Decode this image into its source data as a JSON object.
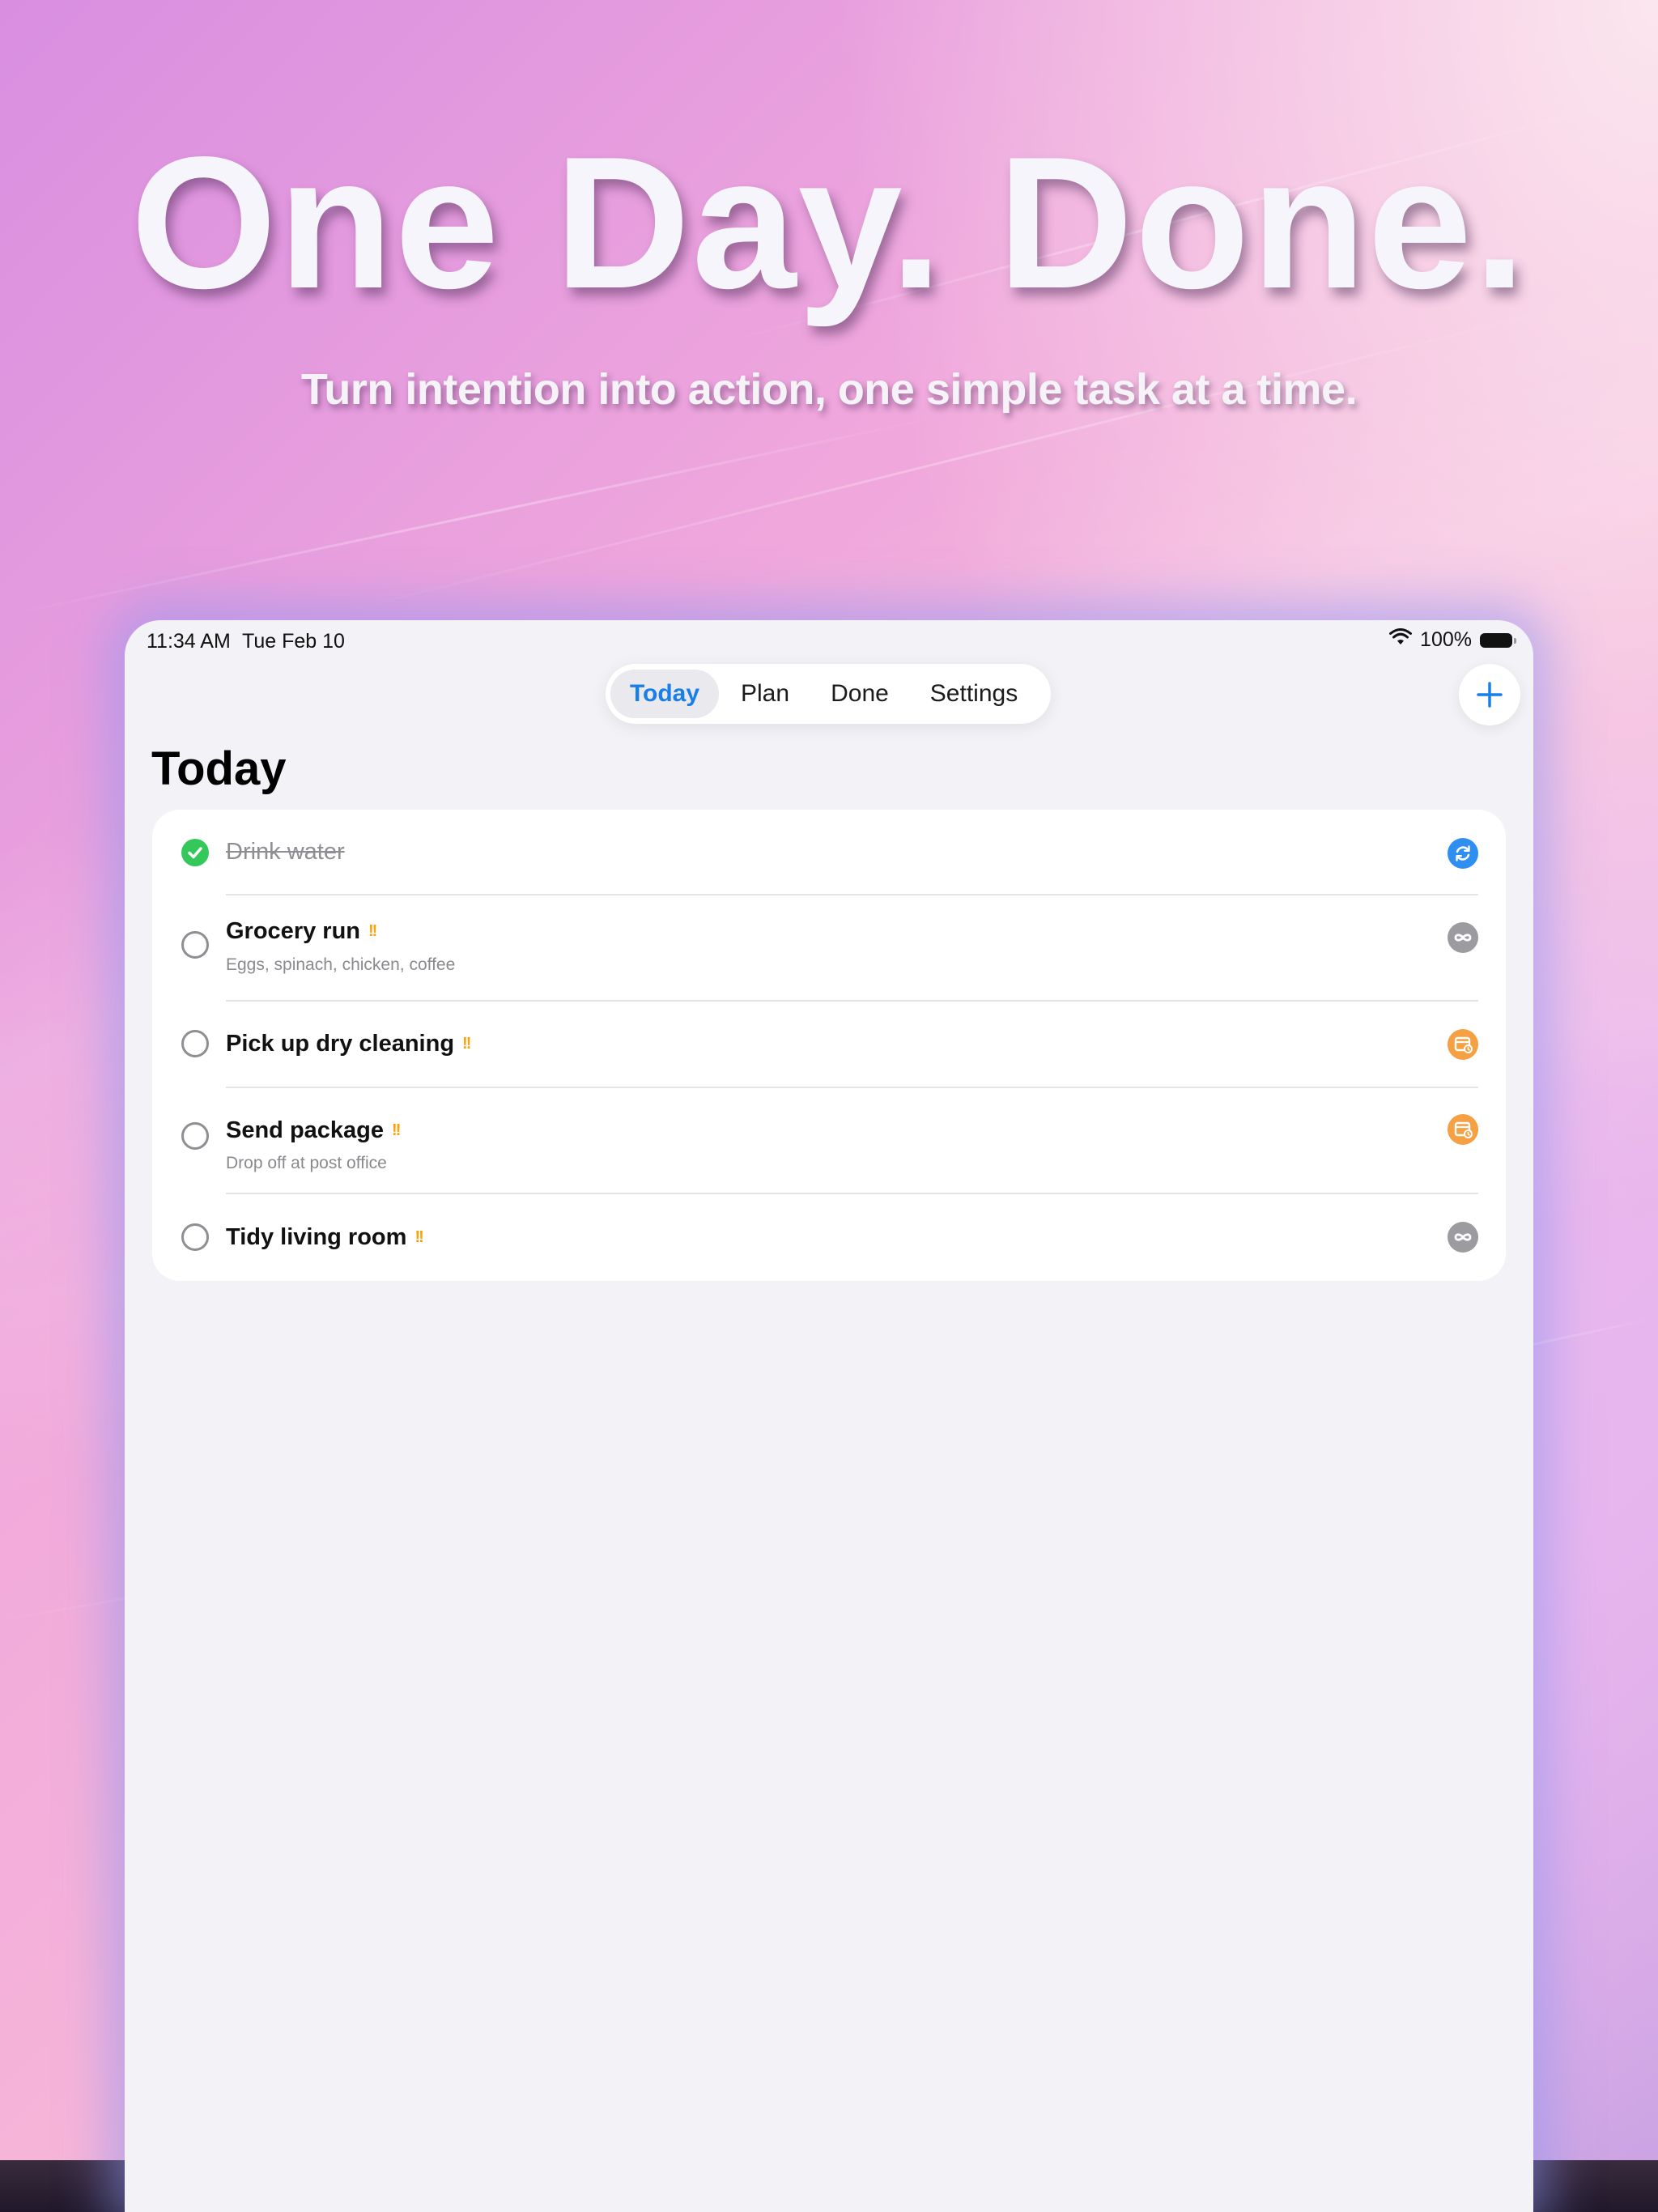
{
  "hero": {
    "title": "One Day. Done.",
    "subtitle": "Turn intention into action, one simple task at a time."
  },
  "status_bar": {
    "time": "11:34 AM",
    "date": "Tue Feb 10",
    "battery": "100%"
  },
  "nav": {
    "tabs": [
      "Today",
      "Plan",
      "Done",
      "Settings"
    ],
    "active_tab": "Today",
    "add_button_icon": "plus-icon"
  },
  "page": {
    "title": "Today"
  },
  "tasks": [
    {
      "title": "Drink water",
      "note": "",
      "completed": true,
      "priority": "",
      "badge_icon": "repeat-icon",
      "badge_color": "#2f8ff0"
    },
    {
      "title": "Grocery run",
      "note": "Eggs, spinach, chicken, coffee",
      "completed": false,
      "priority": "!!",
      "badge_icon": "infinity-icon",
      "badge_color": "#9b9ba0"
    },
    {
      "title": "Pick up dry cleaning",
      "note": "",
      "completed": false,
      "priority": "!!",
      "badge_icon": "calendar-clock-icon",
      "badge_color": "#f5a043"
    },
    {
      "title": "Send package",
      "note": "Drop off at post office",
      "completed": false,
      "priority": "!!",
      "badge_icon": "calendar-clock-icon",
      "badge_color": "#f5a043"
    },
    {
      "title": "Tidy living room",
      "note": "",
      "completed": false,
      "priority": "!!",
      "badge_icon": "infinity-icon",
      "badge_color": "#9b9ba0"
    }
  ],
  "colors": {
    "accent": "#1a7ee8",
    "done_check": "#34c759",
    "priority": "#ff9f0a"
  }
}
